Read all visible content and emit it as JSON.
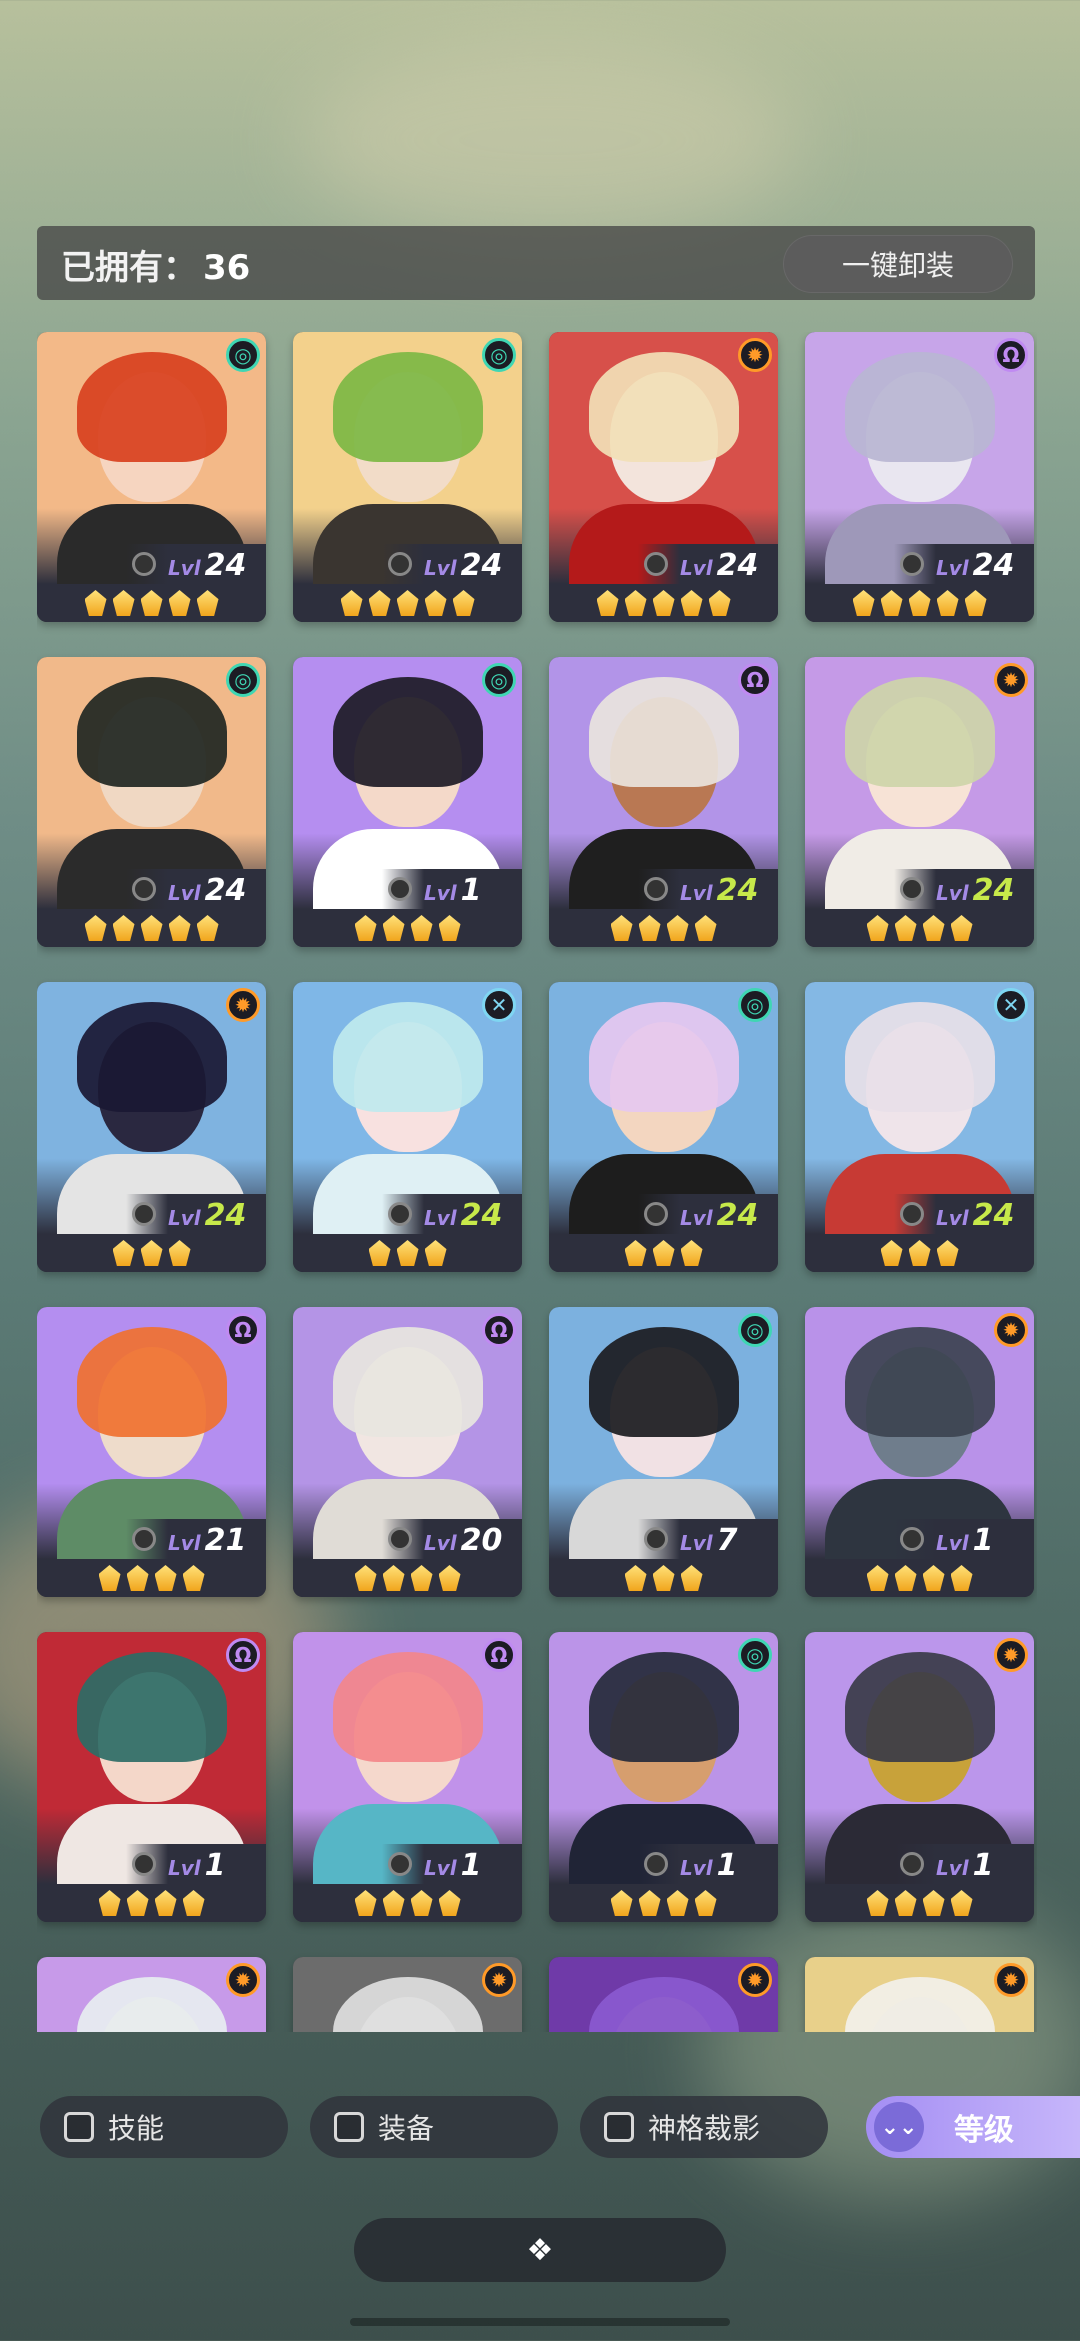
{
  "header": {
    "owned_label": "已拥有：",
    "owned_count": "36",
    "unequip_button": "一键卸装"
  },
  "level_prefix": "Lvl",
  "cards": [
    {
      "element": "wind",
      "level": "24",
      "max": false,
      "stars": 5,
      "bg": "#f3b988",
      "hair": "#d8401e",
      "skin": "#f6d5c0",
      "body": "#2a2a2a"
    },
    {
      "element": "wind",
      "level": "24",
      "max": false,
      "stars": 5,
      "bg": "#f3d18c",
      "hair": "#7db744",
      "skin": "#f2dcc8",
      "body": "#3a3530"
    },
    {
      "element": "sun",
      "level": "24",
      "max": false,
      "stars": 5,
      "bg": "#d7504a",
      "hair": "#f2e0b6",
      "skin": "#f3e4dc",
      "body": "#b41a1a"
    },
    {
      "element": "spirit",
      "level": "24",
      "max": false,
      "stars": 5,
      "bg": "#c7a5e9",
      "hair": "#b9b6d2",
      "skin": "#e9e6f0",
      "body": "#9e98b9"
    },
    {
      "element": "wind",
      "level": "24",
      "max": false,
      "stars": 5,
      "bg": "#f1b98a",
      "hair": "#1f2622",
      "skin": "#f0d8c3",
      "body": "#2b2b2b"
    },
    {
      "element": "wind",
      "level": "1",
      "max": false,
      "stars": 4,
      "bg": "#b58ef0",
      "hair": "#1d1b26",
      "skin": "#f4d9c9",
      "body": "#ffffff"
    },
    {
      "element": "spirit",
      "level": "24",
      "max": true,
      "stars": 4,
      "bg": "#b294e8",
      "hair": "#e9e4dd",
      "skin": "#b97853",
      "body": "#1f1f1f"
    },
    {
      "element": "sun",
      "level": "24",
      "max": true,
      "stars": 4,
      "bg": "#c59ae7",
      "hair": "#cdd5a9",
      "skin": "#f7e3d6",
      "body": "#f0ece6"
    },
    {
      "element": "sun",
      "level": "24",
      "max": true,
      "stars": 3,
      "bg": "#7fb3e0",
      "hair": "#1a1833",
      "skin": "#2a2840",
      "body": "#e4e4e4"
    },
    {
      "element": "void",
      "level": "24",
      "max": true,
      "stars": 3,
      "bg": "#7fb7e7",
      "hair": "#bfe9ee",
      "skin": "#f8e1e0",
      "body": "#dff0f4"
    },
    {
      "element": "wind",
      "level": "24",
      "max": true,
      "stars": 3,
      "bg": "#7cb2e0",
      "hair": "#e6c8f0",
      "skin": "#f3d6c0",
      "body": "#1d1d1d"
    },
    {
      "element": "void",
      "level": "24",
      "max": true,
      "stars": 3,
      "bg": "#84b8e4",
      "hair": "#e8e0e8",
      "skin": "#efe4ea",
      "body": "#c73a34"
    },
    {
      "element": "spirit",
      "level": "21",
      "max": false,
      "stars": 4,
      "bg": "#b48ef0",
      "hair": "#f07130",
      "skin": "#eedccb",
      "body": "#5e8c66"
    },
    {
      "element": "spirit",
      "level": "20",
      "max": false,
      "stars": 4,
      "bg": "#b494e6",
      "hair": "#e8e6df",
      "skin": "#f1e6e2",
      "body": "#e0dcd6"
    },
    {
      "element": "wind",
      "level": "7",
      "max": false,
      "stars": 3,
      "bg": "#7cb1df",
      "hair": "#1b1b1f",
      "skin": "#f1e1e4",
      "body": "#d8d8d8"
    },
    {
      "element": "sun",
      "level": "1",
      "max": false,
      "stars": 4,
      "bg": "#b992e9",
      "hair": "#3c4350",
      "skin": "#6f7d8c",
      "body": "#2e3540"
    },
    {
      "element": "spirit",
      "level": "1",
      "max": false,
      "stars": 4,
      "bg": "#c02a36",
      "hair": "#2d6d66",
      "skin": "#f4d7c9",
      "body": "#efe7e3"
    },
    {
      "element": "spirit",
      "level": "1",
      "max": false,
      "stars": 4,
      "bg": "#c192ea",
      "hair": "#f3878a",
      "skin": "#f5d8cc",
      "body": "#56b6c6"
    },
    {
      "element": "wind",
      "level": "1",
      "max": false,
      "stars": 4,
      "bg": "#bb94e8",
      "hair": "#252a3a",
      "skin": "#d69e6e",
      "body": "#202436"
    },
    {
      "element": "sun",
      "level": "1",
      "max": false,
      "stars": 4,
      "bg": "#bb96eb",
      "hair": "#3a3b48",
      "skin": "#c8a23a",
      "body": "#2b2a36"
    },
    {
      "element": "sun",
      "level": "",
      "max": false,
      "stars": 0,
      "bg": "#c79ae9",
      "hair": "#e7eef0",
      "skin": "#f0dacb",
      "body": "#333"
    },
    {
      "element": "sun",
      "level": "",
      "max": false,
      "stars": 0,
      "bg": "#6c6c6c",
      "hair": "#e0e0e0",
      "skin": "#d9d9d9",
      "body": "#333"
    },
    {
      "element": "sun",
      "level": "",
      "max": false,
      "stars": 0,
      "bg": "#6f3aa8",
      "hair": "#8a5ad0",
      "skin": "#b47c9a",
      "body": "#333"
    },
    {
      "element": "sun",
      "level": "",
      "max": false,
      "stars": 0,
      "bg": "#e8d08a",
      "hair": "#f2f0ea",
      "skin": "#d8c6a0",
      "body": "#333"
    }
  ],
  "element_icons": {
    "wind": {
      "glyph": "◎",
      "color": "#3fd6b3"
    },
    "sun": {
      "glyph": "✹",
      "color": "#ff9a28"
    },
    "spirit": {
      "glyph": "Ω",
      "color": "#c08af2"
    },
    "void": {
      "glyph": "✕",
      "color": "#7fd6f2"
    }
  },
  "filters": {
    "skill": "技能",
    "equipment": "装备",
    "divine_shadow": "神格裁影",
    "sort_label": "等级",
    "sort_chevron": "⌄⌄"
  },
  "bottom_tab_icon": "❖"
}
